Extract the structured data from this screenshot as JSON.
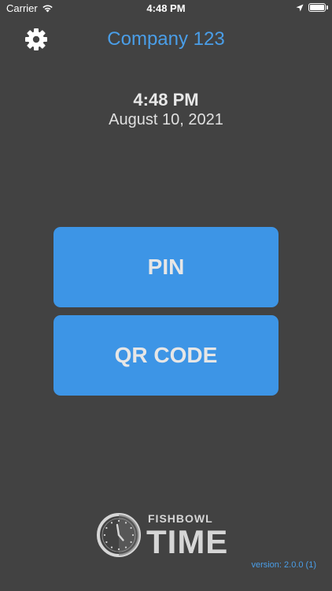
{
  "status_bar": {
    "carrier": "Carrier",
    "time": "4:48 PM",
    "icons": [
      "wifi-icon",
      "location-arrow-icon",
      "battery-icon"
    ]
  },
  "header": {
    "settings_icon": "gear-icon",
    "company": "Company 123"
  },
  "clock": {
    "time": "4:48 PM",
    "date": "August 10, 2021"
  },
  "buttons": {
    "pin": "PIN",
    "qr": "QR CODE"
  },
  "logo": {
    "top_word": "FISHBOWL",
    "main_word": "TIME"
  },
  "footer": {
    "version": "version: 2.0.0 (1)"
  },
  "colors": {
    "background": "#424242",
    "accent": "#4a9ee8",
    "button": "#3d95e6"
  }
}
